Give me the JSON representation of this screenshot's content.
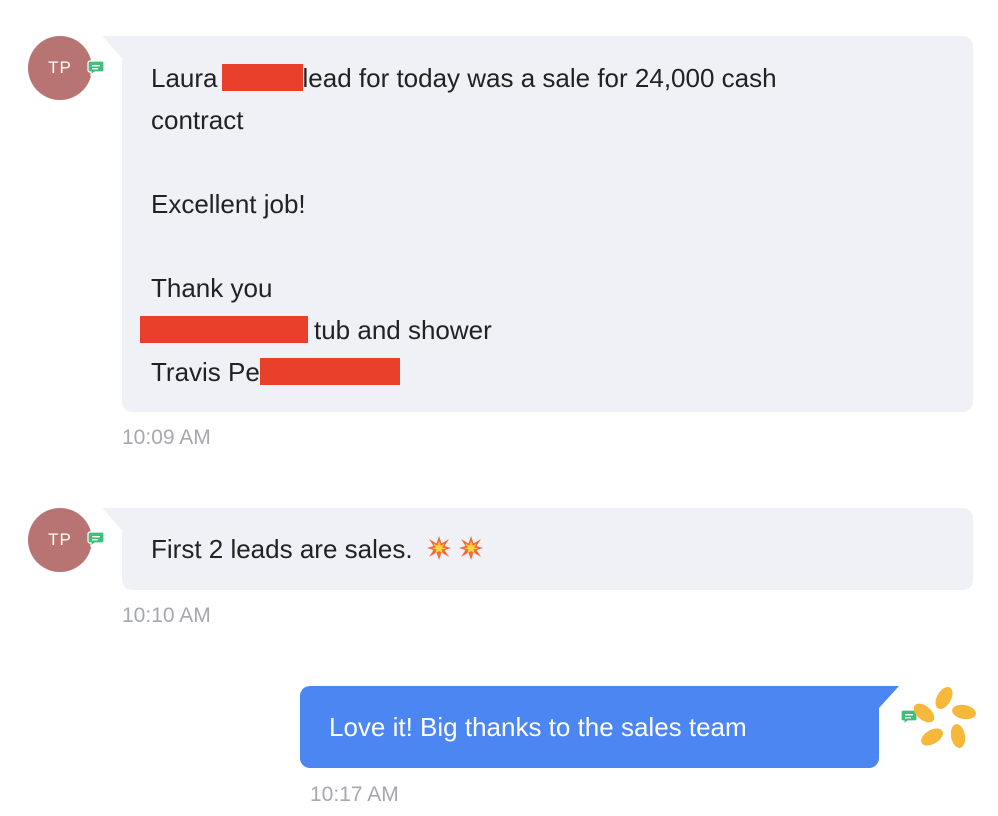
{
  "messages": [
    {
      "avatar_initials": "TP",
      "lines": {
        "l1a": "Laura",
        "l1b": "lead for today was a sale for 24,000 cash",
        "l2": "contract",
        "l4": "Excellent job!",
        "l6": "Thank you",
        "l7": "tub and shower",
        "l8": "Travis Pe"
      },
      "time": "10:09 AM"
    },
    {
      "avatar_initials": "TP",
      "text": "First 2 leads are sales.",
      "emojis": [
        "collision-emoji",
        "collision-emoji"
      ],
      "time": "10:10 AM"
    },
    {
      "text": "Love it! Big thanks to the sales team",
      "time": "10:17 AM"
    }
  ],
  "colors": {
    "incoming_bubble": "#f0f1f6",
    "outgoing_bubble": "#4b86f3",
    "avatar": "#b87472",
    "redaction": "#e8402a",
    "sms_badge": "#3fc07a",
    "logo": "#f5b83a"
  },
  "icons": {
    "channel_badge": "sms-chat-icon",
    "sender_logo": "company-logo-icon"
  }
}
